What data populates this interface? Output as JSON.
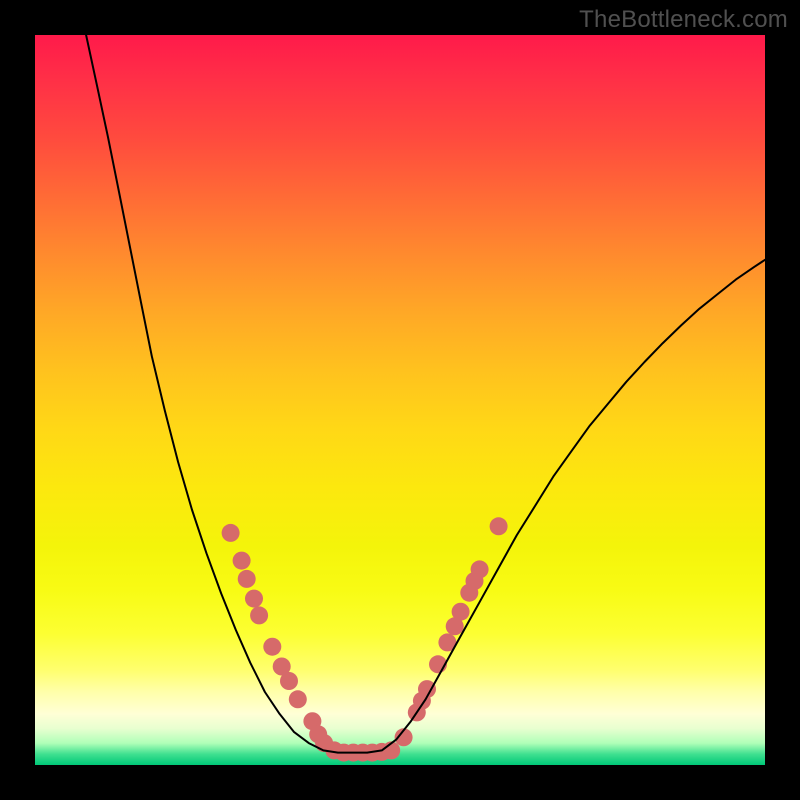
{
  "watermark": "TheBottleneck.com",
  "chart_data": {
    "type": "line",
    "title": "",
    "xlabel": "",
    "ylabel": "",
    "xlim": [
      0,
      100
    ],
    "ylim": [
      0,
      100
    ],
    "grid": false,
    "note": "x/y read in percent of plotting-area width/height, top-left origin",
    "series": [
      {
        "name": "curve",
        "style": "black-line",
        "points": [
          {
            "x": 7.0,
            "y": 0.0
          },
          {
            "x": 8.5,
            "y": 7.0
          },
          {
            "x": 10.0,
            "y": 14.0
          },
          {
            "x": 11.5,
            "y": 21.5
          },
          {
            "x": 13.0,
            "y": 29.0
          },
          {
            "x": 14.5,
            "y": 36.5
          },
          {
            "x": 16.0,
            "y": 44.0
          },
          {
            "x": 17.8,
            "y": 51.5
          },
          {
            "x": 19.6,
            "y": 58.5
          },
          {
            "x": 21.5,
            "y": 65.0
          },
          {
            "x": 23.5,
            "y": 71.0
          },
          {
            "x": 25.5,
            "y": 76.5
          },
          {
            "x": 27.5,
            "y": 81.5
          },
          {
            "x": 29.5,
            "y": 86.0
          },
          {
            "x": 31.5,
            "y": 90.0
          },
          {
            "x": 33.5,
            "y": 93.0
          },
          {
            "x": 35.5,
            "y": 95.5
          },
          {
            "x": 37.5,
            "y": 97.0
          },
          {
            "x": 39.5,
            "y": 98.0
          },
          {
            "x": 41.5,
            "y": 98.3
          },
          {
            "x": 43.5,
            "y": 98.3
          },
          {
            "x": 45.5,
            "y": 98.3
          },
          {
            "x": 47.5,
            "y": 98.0
          },
          {
            "x": 49.5,
            "y": 96.5
          },
          {
            "x": 51.5,
            "y": 94.0
          },
          {
            "x": 53.5,
            "y": 91.0
          },
          {
            "x": 56.0,
            "y": 86.5
          },
          {
            "x": 58.5,
            "y": 82.0
          },
          {
            "x": 61.0,
            "y": 77.5
          },
          {
            "x": 63.5,
            "y": 73.0
          },
          {
            "x": 66.0,
            "y": 68.5
          },
          {
            "x": 68.5,
            "y": 64.5
          },
          {
            "x": 71.0,
            "y": 60.5
          },
          {
            "x": 73.5,
            "y": 57.0
          },
          {
            "x": 76.0,
            "y": 53.5
          },
          {
            "x": 78.5,
            "y": 50.5
          },
          {
            "x": 81.0,
            "y": 47.5
          },
          {
            "x": 83.5,
            "y": 44.8
          },
          {
            "x": 86.0,
            "y": 42.2
          },
          {
            "x": 88.5,
            "y": 39.8
          },
          {
            "x": 91.0,
            "y": 37.5
          },
          {
            "x": 93.5,
            "y": 35.5
          },
          {
            "x": 96.0,
            "y": 33.5
          },
          {
            "x": 98.5,
            "y": 31.8
          },
          {
            "x": 100.0,
            "y": 30.8
          }
        ]
      },
      {
        "name": "dots",
        "style": "salmon-dot",
        "points": [
          {
            "x": 26.8,
            "y": 68.2
          },
          {
            "x": 28.3,
            "y": 72.0
          },
          {
            "x": 29.0,
            "y": 74.5
          },
          {
            "x": 30.0,
            "y": 77.2
          },
          {
            "x": 30.7,
            "y": 79.5
          },
          {
            "x": 32.5,
            "y": 83.8
          },
          {
            "x": 33.8,
            "y": 86.5
          },
          {
            "x": 34.8,
            "y": 88.5
          },
          {
            "x": 36.0,
            "y": 91.0
          },
          {
            "x": 38.0,
            "y": 94.0
          },
          {
            "x": 38.8,
            "y": 95.8
          },
          {
            "x": 39.6,
            "y": 97.0
          },
          {
            "x": 41.0,
            "y": 98.0
          },
          {
            "x": 42.3,
            "y": 98.3
          },
          {
            "x": 43.6,
            "y": 98.3
          },
          {
            "x": 44.9,
            "y": 98.3
          },
          {
            "x": 46.2,
            "y": 98.3
          },
          {
            "x": 47.5,
            "y": 98.2
          },
          {
            "x": 48.8,
            "y": 98.0
          },
          {
            "x": 50.5,
            "y": 96.2
          },
          {
            "x": 52.3,
            "y": 92.8
          },
          {
            "x": 53.0,
            "y": 91.2
          },
          {
            "x": 53.7,
            "y": 89.6
          },
          {
            "x": 55.2,
            "y": 86.2
          },
          {
            "x": 56.5,
            "y": 83.2
          },
          {
            "x": 57.5,
            "y": 81.0
          },
          {
            "x": 58.3,
            "y": 79.0
          },
          {
            "x": 59.5,
            "y": 76.4
          },
          {
            "x": 60.2,
            "y": 74.8
          },
          {
            "x": 60.9,
            "y": 73.2
          },
          {
            "x": 63.5,
            "y": 67.3
          }
        ]
      }
    ]
  },
  "colors": {
    "dot_fill": "#d66a6a",
    "curve": "#000000"
  }
}
